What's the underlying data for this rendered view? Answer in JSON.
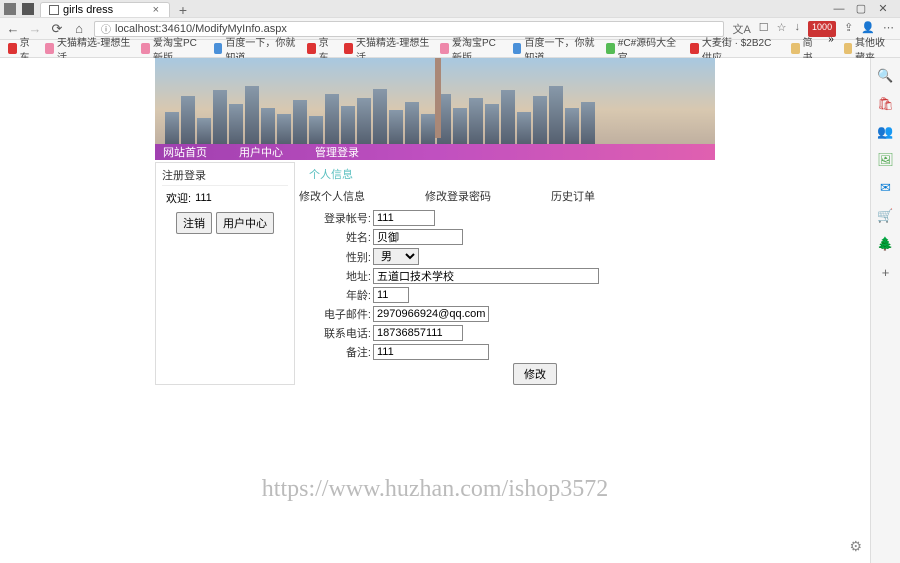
{
  "window": {
    "tab_title": "girls dress",
    "url": "localhost:34610/ModifyMyInfo.aspx",
    "badge_1000": "1000"
  },
  "bookmarks": {
    "items": [
      {
        "label": "京东"
      },
      {
        "label": "天猫精选-理想生活…"
      },
      {
        "label": "爱淘宝PC新版"
      },
      {
        "label": "百度一下，你就知道"
      },
      {
        "label": "京东"
      },
      {
        "label": "天猫精选-理想生活…"
      },
      {
        "label": "爱淘宝PC新版"
      },
      {
        "label": "百度一下，你就知道"
      },
      {
        "label": "#C#源码大全官…"
      },
      {
        "label": "大麦街 · $2B2C供应…"
      },
      {
        "label": "简书"
      }
    ],
    "right_label": "其他收藏夹"
  },
  "nav": {
    "home": "网站首页",
    "user_center": "用户中心",
    "admin_login": "管理登录"
  },
  "login": {
    "title": "注册登录",
    "welcome_label": "欢迎:",
    "username": "111",
    "logout": "注销",
    "user_center": "用户中心"
  },
  "section": {
    "breadcrumb": "个人信息",
    "tabs": {
      "modify_info": "修改个人信息",
      "modify_pwd": "修改登录密码",
      "history": "历史订单"
    }
  },
  "form": {
    "account_label": "登录帐号:",
    "account_value": "111",
    "name_label": "姓名:",
    "name_value": "贝御",
    "gender_label": "性别:",
    "gender_value": "男",
    "address_label": "地址:",
    "address_value": "五道口技术学校",
    "age_label": "年龄:",
    "age_value": "11",
    "email_label": "电子邮件:",
    "email_value": "2970966924@qq.com",
    "phone_label": "联系电话:",
    "phone_value": "18736857111",
    "remark_label": "备注:",
    "remark_value": "111",
    "submit": "修改"
  },
  "watermark": "https://www.huzhan.com/ishop3572"
}
